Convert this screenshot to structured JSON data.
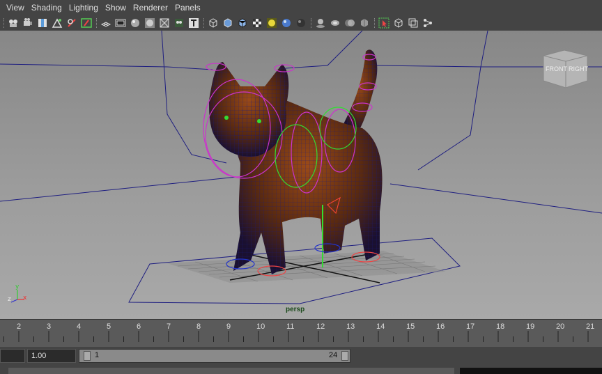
{
  "menu": [
    "View",
    "Shading",
    "Lighting",
    "Show",
    "Renderer",
    "Panels"
  ],
  "toolbar_icons": [
    "select-camera-icon",
    "camera-attributes-icon",
    "bookmarks-icon",
    "image-plane-icon",
    "2d-pan-zoom-icon",
    "grease-pencil-icon",
    "grid-icon",
    "film-gate-icon",
    "resolution-gate-icon",
    "gate-mask-icon",
    "field-chart-icon",
    "safe-title-icon",
    "wireframe-icon",
    "smooth-shade-icon",
    "wireframe-on-shaded-icon",
    "textured-icon",
    "use-all-lights-icon",
    "shadows-icon",
    "ambient-occlusion-icon",
    "motion-blur-icon",
    "multisample-icon",
    "depth-of-field-icon",
    "xray-icon",
    "isolate-select-icon",
    "xray-joints-icon",
    "xray-active-icon",
    "camera-sequencer-icon"
  ],
  "viewport": {
    "camera_label": "persp",
    "view_cube_front": "FRONT",
    "view_cube_right": "RIGHT",
    "axis_y": "y",
    "axis_x": "x",
    "axis_z": "z"
  },
  "timeline": {
    "ticks": [
      "2",
      "3",
      "4",
      "5",
      "6",
      "7",
      "8",
      "9",
      "10",
      "11",
      "12",
      "13",
      "14",
      "15",
      "16",
      "17",
      "18",
      "19",
      "20",
      "21"
    ]
  },
  "range": {
    "start_value": "1.00",
    "range_start": "1",
    "range_end": "24"
  },
  "colors": {
    "viewport_bg_top": "#8c8c8c",
    "viewport_bg_bottom": "#a8a8a8",
    "grid_lines": "#1a1a7a",
    "control_magenta": "#cc33cc",
    "control_green": "#33dd33",
    "cat_fur": "#7a3a14"
  }
}
